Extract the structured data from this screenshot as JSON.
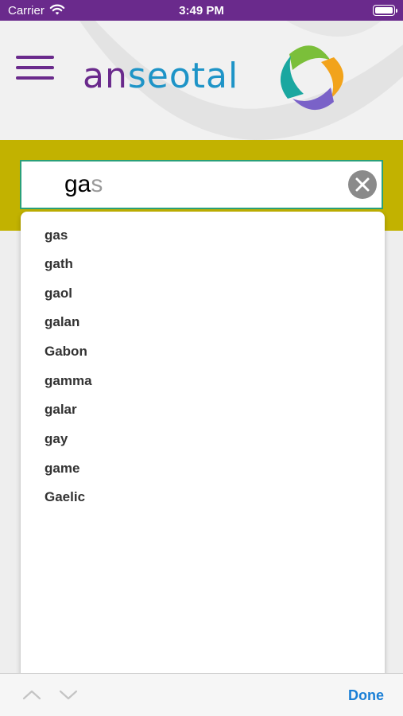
{
  "status_bar": {
    "carrier": "Carrier",
    "time": "3:49 PM",
    "icons": [
      "wifi-icon",
      "battery-icon"
    ]
  },
  "header": {
    "logo_text_part1": "an",
    "logo_text_part2": "seotal",
    "colors": {
      "purple": "#6a2a8c",
      "blue": "#1e94c7",
      "band": "#c2b200",
      "orange": "#f2a31b",
      "teal": "#1aa7a0",
      "green": "#7bbf3a",
      "violet": "#7a62c8"
    }
  },
  "search": {
    "typed": "ga",
    "hint": "s",
    "clear_icon": "clear-icon"
  },
  "suggestions": [
    "gas",
    "gath",
    "gaol",
    "galan",
    "Gabon",
    "gamma",
    "galar",
    "gay",
    "game",
    "Gaelic"
  ],
  "toolbar": {
    "prev_icon": "chevron-up-icon",
    "next_icon": "chevron-down-icon",
    "done_label": "Done",
    "done_color": "#1a7fd6"
  }
}
